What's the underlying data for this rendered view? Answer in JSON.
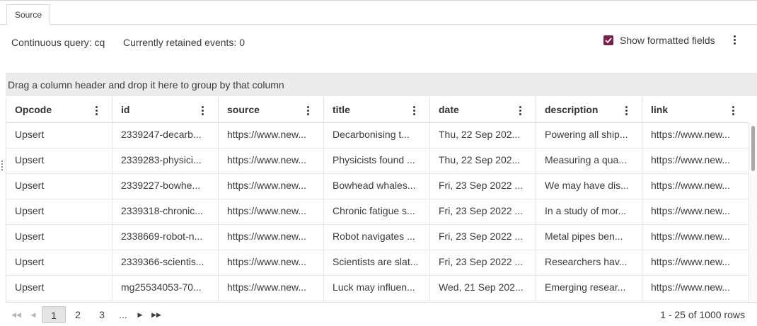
{
  "tabs": [
    {
      "label": "Source"
    }
  ],
  "info": {
    "continuous_query": "Continuous query: cq",
    "retained_events": "Currently retained events: 0"
  },
  "formatted_fields": {
    "label": "Show formatted fields",
    "checked": true,
    "color": "#7b1e4b"
  },
  "group_bar": "Drag a column header and drop it here to group by that column",
  "columns": [
    "Opcode",
    "id",
    "source",
    "title",
    "date",
    "description",
    "link"
  ],
  "rows": [
    [
      "Upsert",
      "2339247-decarb...",
      "https://www.new...",
      "Decarbonising t...",
      "Thu, 22 Sep 202...",
      "Powering all ship...",
      "https://www.new..."
    ],
    [
      "Upsert",
      "2339283-physici...",
      "https://www.new...",
      "Physicists found ...",
      "Thu, 22 Sep 202...",
      "Measuring a qua...",
      "https://www.new..."
    ],
    [
      "Upsert",
      "2339227-bowhe...",
      "https://www.new...",
      "Bowhead whales...",
      "Fri, 23 Sep 2022 ...",
      "We may have dis...",
      "https://www.new..."
    ],
    [
      "Upsert",
      "2339318-chronic...",
      "https://www.new...",
      "Chronic fatigue s...",
      "Fri, 23 Sep 2022 ...",
      "In a study of mor...",
      "https://www.new..."
    ],
    [
      "Upsert",
      "2338669-robot-n...",
      "https://www.new...",
      "Robot navigates ...",
      "Fri, 23 Sep 2022 ...",
      "Metal pipes ben...",
      "https://www.new..."
    ],
    [
      "Upsert",
      "2339366-scientis...",
      "https://www.new...",
      "Scientists are slat...",
      "Fri, 23 Sep 2022 ...",
      "Researchers hav...",
      "https://www.new..."
    ],
    [
      "Upsert",
      "mg25534053-70...",
      "https://www.new...",
      "Luck may influen...",
      "Wed, 21 Sep 202...",
      "Emerging resear...",
      "https://www.new..."
    ]
  ],
  "pager": {
    "pages": [
      "1",
      "2",
      "3",
      "..."
    ],
    "current_page": "1",
    "row_count": "1 - 25 of 1000 rows",
    "first_icon": "first-page-icon",
    "prev_icon": "previous-page-icon",
    "next_icon": "next-page-icon",
    "last_icon": "last-page-icon"
  }
}
